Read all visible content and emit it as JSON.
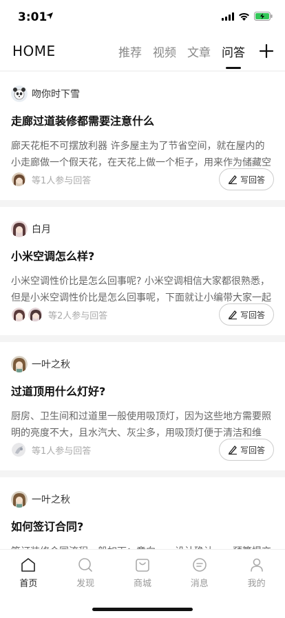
{
  "status": {
    "time": "3:01"
  },
  "header": {
    "title": "HOME",
    "tabs": [
      {
        "label": "推荐",
        "active": false
      },
      {
        "label": "视频",
        "active": false
      },
      {
        "label": "文章",
        "active": false
      },
      {
        "label": "问答",
        "active": true
      }
    ]
  },
  "cards": [
    {
      "username": "吻你时下雪",
      "title": "走廊过道装修都需要注意什么",
      "body": "廊天花柜不可摆放利器 许多屋主为了节省空间，就在屋内的小走廊做一个假天花，在天花上做一个柜子，用来作为储藏空间。",
      "participants": "等1人参与回答",
      "answer_label": "写回答"
    },
    {
      "username": "白月",
      "title": "小米空调怎么样?",
      "body": "小米空调性价比是怎么回事呢? 小米空调相信大家都很熟悉，但是小米空调性价比是怎么回事呢，下面就让小编带大家一起了解吧。",
      "participants": "等2人参与回答",
      "answer_label": "写回答"
    },
    {
      "username": "一叶之秋",
      "title": "过道顶用什么灯好?",
      "body": "厨房、卫生间和过道里一般使用吸顶灯，因为这些地方需要照明的亮度不大，且水汽大、灰尘多，用吸顶灯便于清洁和维护。",
      "participants": "等1人参与回答",
      "answer_label": "写回答"
    },
    {
      "username": "一叶之秋",
      "title": "如何签订合同?",
      "body": "签订装修合同流程一般如下：意向——设计确认——预算提交",
      "participants": "",
      "answer_label": ""
    }
  ],
  "tabbar": [
    {
      "label": "首页",
      "icon": "home-icon",
      "active": true
    },
    {
      "label": "发现",
      "icon": "search-icon",
      "active": false
    },
    {
      "label": "商城",
      "icon": "shop-bag-icon",
      "active": false
    },
    {
      "label": "消息",
      "icon": "message-icon",
      "active": false
    },
    {
      "label": "我的",
      "icon": "profile-icon",
      "active": false
    }
  ]
}
